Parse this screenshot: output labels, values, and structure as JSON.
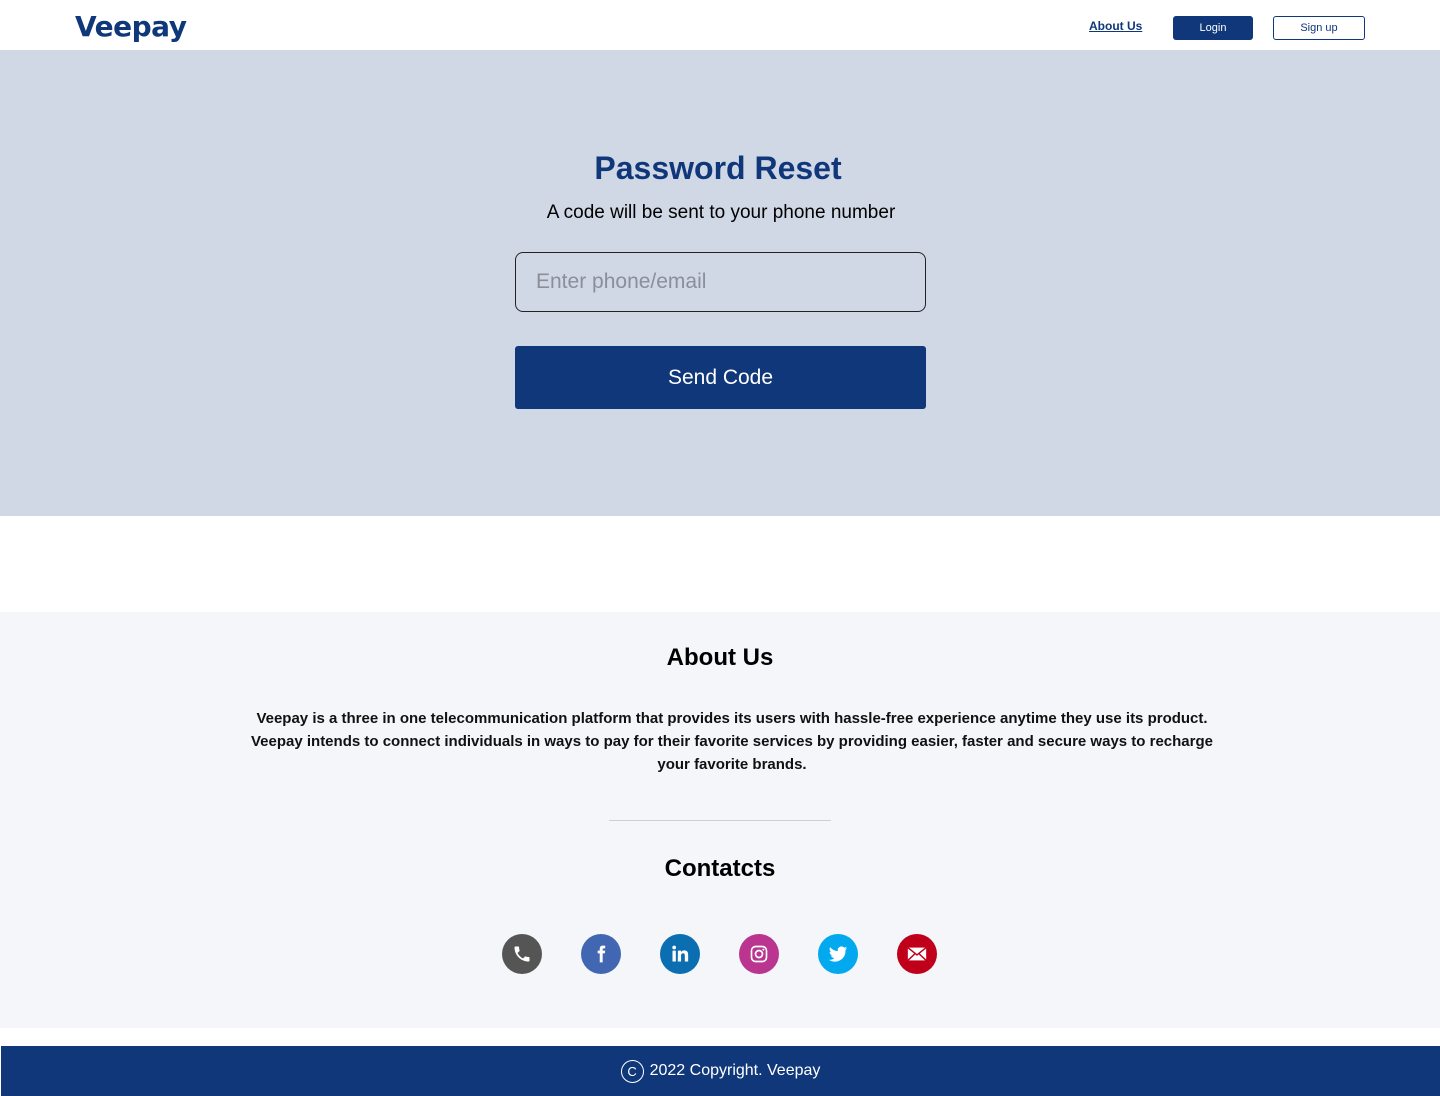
{
  "header": {
    "logo": "Veepay",
    "nav_about": "About Us",
    "login_label": "Login",
    "signup_label": "Sign up"
  },
  "reset": {
    "title": "Password Reset",
    "subtitle": "A code will be sent to your phone number",
    "input_placeholder": "Enter phone/email",
    "input_value": "",
    "send_label": "Send Code"
  },
  "about": {
    "title": "About Us",
    "text": "Veepay is a three in one telecommunication platform that provides its users with hassle-free experience anytime they use its product. Veepay intends to connect individuals in ways to pay for their favorite services by providing easier, faster and secure ways to recharge your favorite brands."
  },
  "contacts": {
    "title": "Contatcts",
    "icons": [
      {
        "name": "phone-icon",
        "color": "#555555"
      },
      {
        "name": "facebook-icon",
        "color": "#4267b2"
      },
      {
        "name": "linkedin-icon",
        "color": "#0a6eb0"
      },
      {
        "name": "instagram-icon",
        "color": "#b9358f"
      },
      {
        "name": "twitter-icon",
        "color": "#03a9ee"
      },
      {
        "name": "email-icon",
        "color": "#c0001b"
      }
    ]
  },
  "footer": {
    "copyright_symbol": "C",
    "text": "2022 Copyright. Veepay"
  },
  "colors": {
    "brand": "#0f377a",
    "hero_bg": "#d0d8e5",
    "about_bg": "#f4f6fa"
  }
}
